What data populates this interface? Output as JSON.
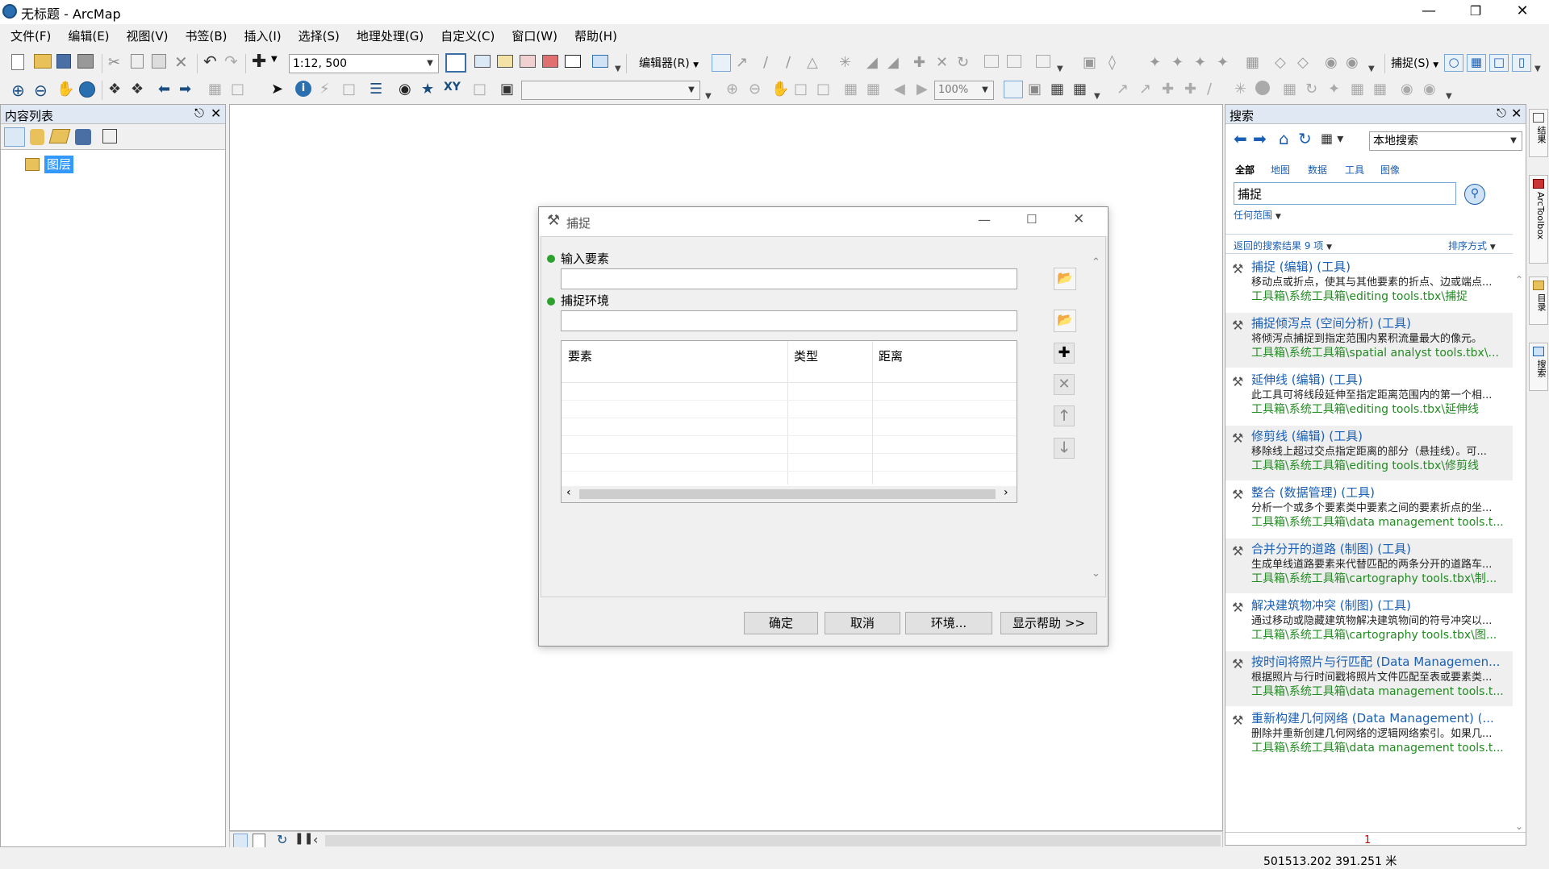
{
  "window": {
    "title": "无标题 - ArcMap"
  },
  "menubar": [
    "文件(F)",
    "编辑(E)",
    "视图(V)",
    "书签(B)",
    "插入(I)",
    "选择(S)",
    "地理处理(G)",
    "自定义(C)",
    "窗口(W)",
    "帮助(H)"
  ],
  "toolbar": {
    "scale": "1:12, 500",
    "editor_label": "编辑器(R)",
    "snapping_label": "捕捉(S)",
    "zoom_percent": "100%"
  },
  "toc": {
    "title": "内容列表",
    "layer_root": "图层"
  },
  "dialog": {
    "title": "捕捉",
    "input_features_label": "输入要素",
    "snap_env_label": "捕捉环境",
    "table_headers": [
      "要素",
      "类型",
      "距离"
    ],
    "buttons": {
      "ok": "确定",
      "cancel": "取消",
      "env": "环境...",
      "help": "显示帮助 >>"
    }
  },
  "search": {
    "title": "搜索",
    "scope": "本地搜索",
    "filters": [
      "全部",
      "地图",
      "数据",
      "工具",
      "图像"
    ],
    "query": "捕捉",
    "range": "任何范围",
    "results_count": "返回的搜索结果 9 项",
    "sort": "排序方式",
    "results": [
      {
        "title": "捕捉 (编辑) (工具)",
        "desc": "移动点或折点，使其与其他要素的折点、边或端点...",
        "path": "工具箱\\系统工具箱\\editing tools.tbx\\捕捉"
      },
      {
        "title": "捕捉倾泻点 (空间分析) (工具)",
        "desc": "将倾泻点捕捉到指定范围内累积流量最大的像元。",
        "path": "工具箱\\系统工具箱\\spatial analyst tools.tbx\\..."
      },
      {
        "title": "延伸线 (编辑) (工具)",
        "desc": "此工具可将线段延伸至指定距离范围内的第一个相...",
        "path": "工具箱\\系统工具箱\\editing tools.tbx\\延伸线"
      },
      {
        "title": "修剪线 (编辑) (工具)",
        "desc": "移除线上超过交点指定距离的部分（悬挂线）。可...",
        "path": "工具箱\\系统工具箱\\editing tools.tbx\\修剪线"
      },
      {
        "title": "整合 (数据管理) (工具)",
        "desc": "分析一个或多个要素类中要素之间的要素折点的坐...",
        "path": "工具箱\\系统工具箱\\data management tools.t..."
      },
      {
        "title": "合并分开的道路 (制图) (工具)",
        "desc": "生成单线道路要素来代替匹配的两条分开的道路车...",
        "path": "工具箱\\系统工具箱\\cartography tools.tbx\\制..."
      },
      {
        "title": "解决建筑物冲突 (制图) (工具)",
        "desc": "通过移动或隐藏建筑物解决建筑物间的符号冲突以...",
        "path": "工具箱\\系统工具箱\\cartography tools.tbx\\图..."
      },
      {
        "title": "按时间将照片与行匹配 (Data Managemen...",
        "desc": "根据照片与行时间戳将照片文件匹配至表或要素类...",
        "path": "工具箱\\系统工具箱\\data management tools.t..."
      },
      {
        "title": "重新构建几何网络 (Data Management) (...",
        "desc": "删除并重新创建几何网络的逻辑网络索引。如果几...",
        "path": "工具箱\\系统工具箱\\data management tools.t..."
      }
    ],
    "page_number": "1"
  },
  "right_tabs": [
    "结果",
    "ArcToolbox",
    "目录",
    "搜索"
  ],
  "status": {
    "coords": "501513.202  391.251 米"
  },
  "colors": {
    "link": "#1a5fb4",
    "path": "#228b22",
    "selected_layer": "#3399ff"
  }
}
